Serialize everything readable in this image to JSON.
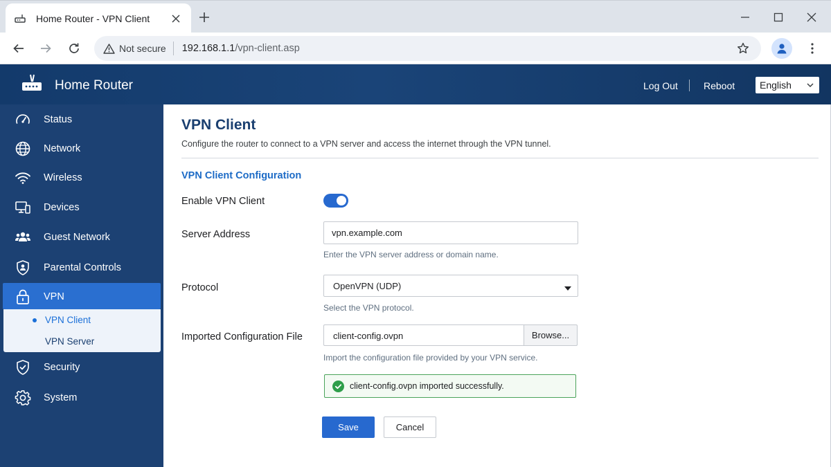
{
  "browser": {
    "tab_title": "Home Router - VPN Client",
    "security_label": "Not secure",
    "url_host": "192.168.1.1",
    "url_path": "/vpn-client.asp"
  },
  "header": {
    "brand": "Home Router",
    "logout_label": "Log Out",
    "reboot_label": "Reboot",
    "language": "English"
  },
  "sidebar": {
    "items": [
      {
        "label": "Status",
        "icon": "speedometer-icon"
      },
      {
        "label": "Network",
        "icon": "globe-icon"
      },
      {
        "label": "Wireless",
        "icon": "wifi-icon"
      },
      {
        "label": "Devices",
        "icon": "devices-icon"
      },
      {
        "label": "Guest Network",
        "icon": "users-icon"
      },
      {
        "label": "Parental Controls",
        "icon": "shield-user-icon"
      },
      {
        "label": "VPN",
        "icon": "lock-icon"
      },
      {
        "label": "Security",
        "icon": "shield-check-icon"
      },
      {
        "label": "System",
        "icon": "gear-icon"
      }
    ],
    "vpn_subitems": [
      {
        "label": "VPN Client"
      },
      {
        "label": "VPN Server"
      }
    ]
  },
  "page": {
    "title": "VPN Client",
    "description": "Configure the router to connect to a VPN server and access the internet through the VPN tunnel.",
    "section_title": "VPN Client Configuration",
    "enable_label": "Enable VPN Client",
    "enable_value": true,
    "server_label": "Server Address",
    "server_value": "vpn.example.com",
    "server_help": "Enter the VPN server address or domain name.",
    "protocol_label": "Protocol",
    "protocol_value": "OpenVPN (UDP)",
    "protocol_help": "Select the VPN protocol.",
    "config_label": "Imported Configuration File",
    "config_value": "client-config.ovpn",
    "browse_label": "Browse...",
    "config_help": "Import the configuration file provided by your VPN service.",
    "success_message": "client-config.ovpn imported successfully.",
    "save_label": "Save",
    "cancel_label": "Cancel"
  },
  "colors": {
    "header_bg": "#1a4478",
    "sidebar_bg": "#1c4173",
    "accent": "#2769cf",
    "title": "#1a3f70",
    "success": "#2e9e4a"
  }
}
